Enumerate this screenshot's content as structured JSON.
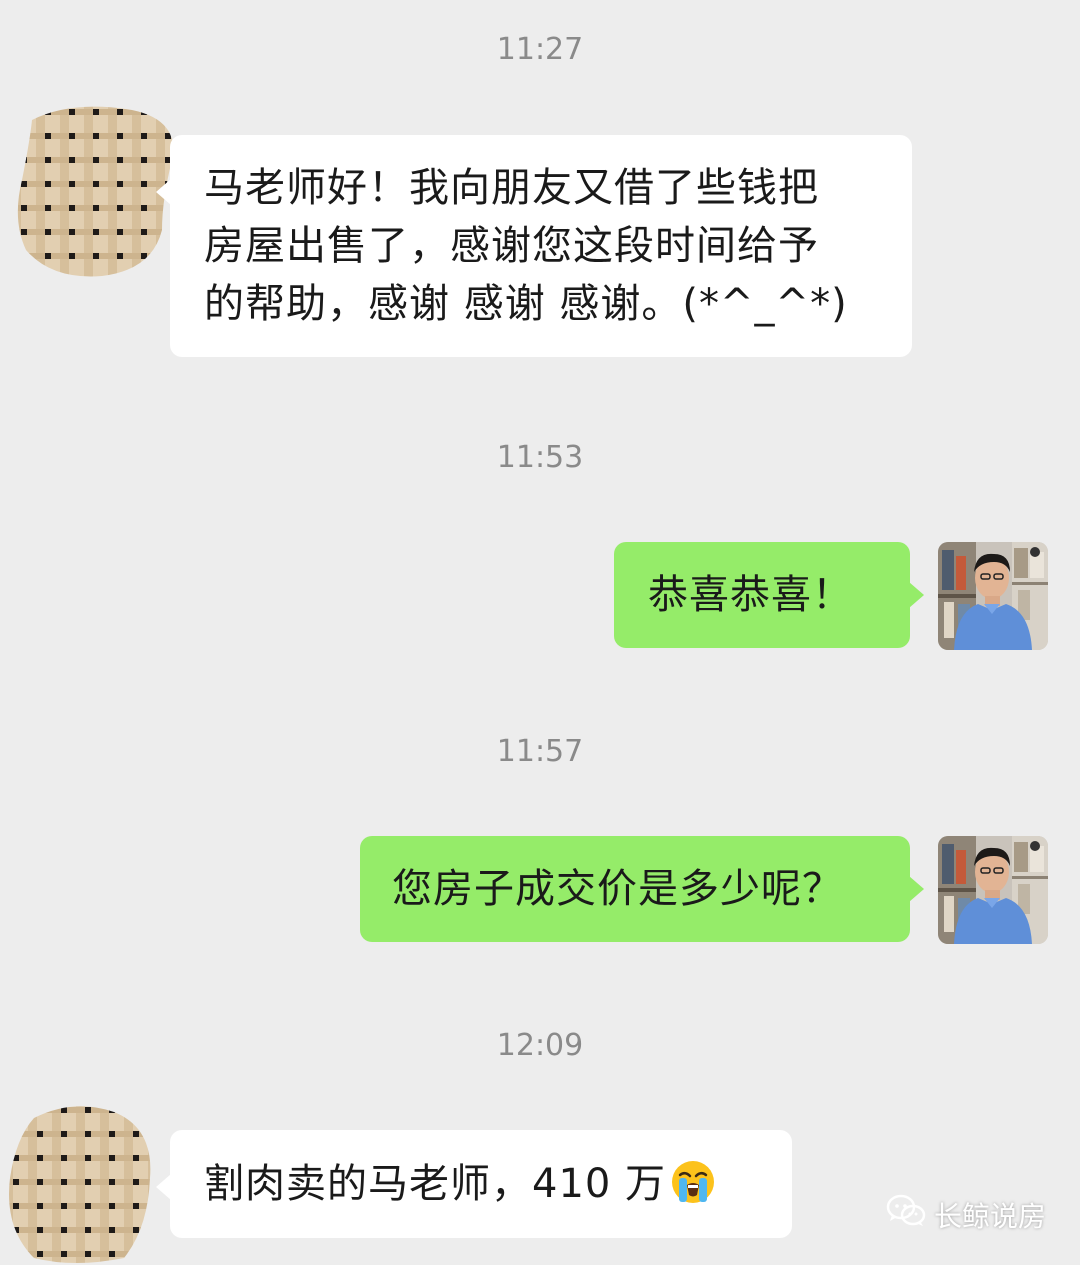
{
  "chat": {
    "messages": [
      {
        "timestamp": "11:27",
        "direction": "incoming",
        "text": "马老师好！我向朋友又借了些钱把房屋出售了，感谢您这段时间给予的帮助，感谢  感谢 感谢。(*^_^*)"
      },
      {
        "timestamp": "11:53",
        "direction": "outgoing",
        "text": "恭喜恭喜！"
      },
      {
        "timestamp": "11:57",
        "direction": "outgoing",
        "text": "您房子成交价是多少呢？"
      },
      {
        "timestamp": "12:09",
        "direction": "incoming",
        "text": "割肉卖的马老师，410 万",
        "emoji": "loudly-crying-face"
      }
    ],
    "lines": {
      "msg1_line1": "马老师好！我向朋友又借了些钱把",
      "msg1_line2": "房屋出售了，感谢您这段时间给予",
      "msg1_line3": "的帮助，感谢  感谢 感谢。(*^_^*)"
    }
  },
  "watermark": {
    "text": "长鲸说房",
    "icon": "wechat-icon"
  },
  "colors": {
    "background": "#ededed",
    "incoming_bubble": "#ffffff",
    "outgoing_bubble": "#95ec69",
    "timestamp": "#8a8a8a"
  }
}
